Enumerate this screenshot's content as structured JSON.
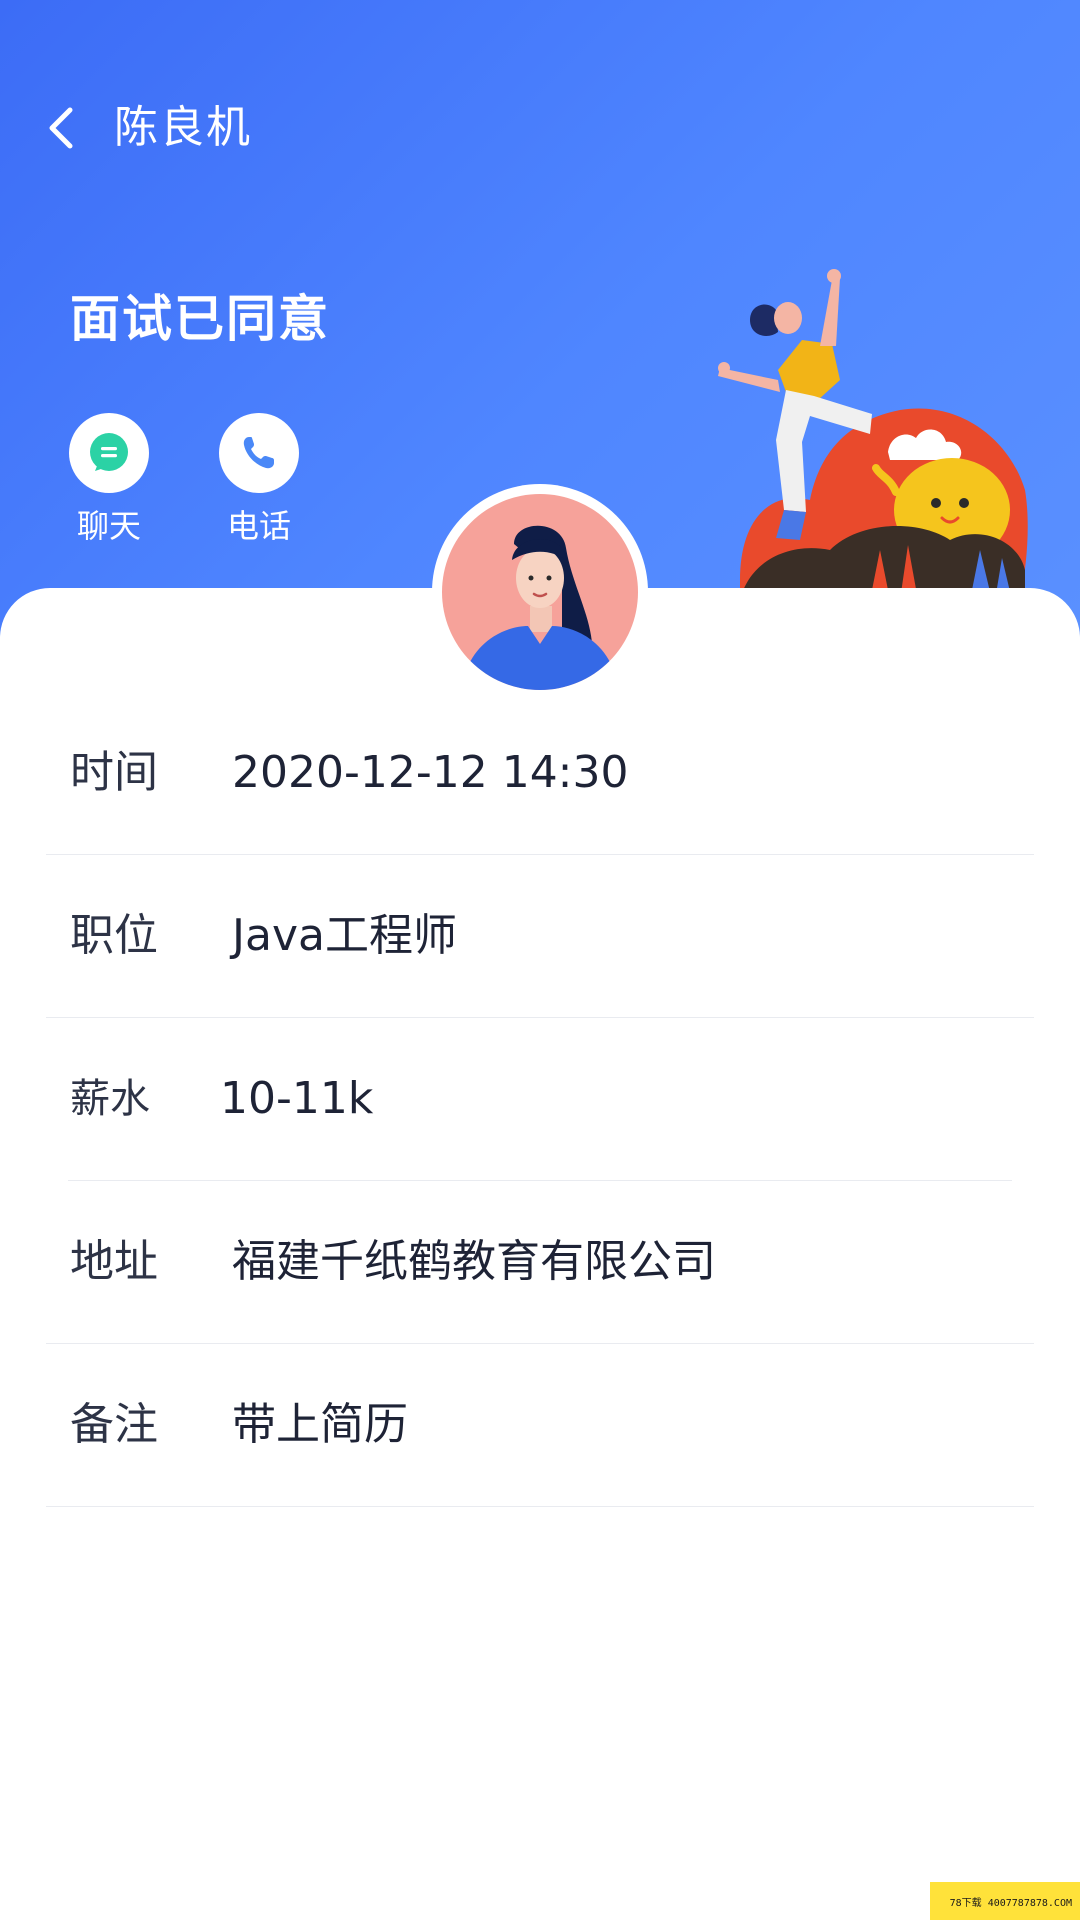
{
  "nav": {
    "title": "陈良机"
  },
  "status": {
    "title": "面试已同意"
  },
  "actions": [
    {
      "label": "聊天",
      "icon": "chat-icon",
      "color": "#2bd2a5"
    },
    {
      "label": "电话",
      "icon": "phone-icon",
      "color": "#4a88f7"
    }
  ],
  "details": [
    {
      "key": "时间",
      "value": "2020-12-12 14:30"
    },
    {
      "key": "职位",
      "value": "Java工程师"
    },
    {
      "key": "薪水",
      "value": "10-11k"
    },
    {
      "key": "地址",
      "value": "福建千纸鹤教育有限公司"
    },
    {
      "key": "备注",
      "value": "带上简历"
    }
  ],
  "watermark": "78下载 4007787878.COM",
  "colors": {
    "header_start": "#3c6cf6",
    "header_end": "#5a90ff",
    "text_primary": "#1e2336"
  }
}
